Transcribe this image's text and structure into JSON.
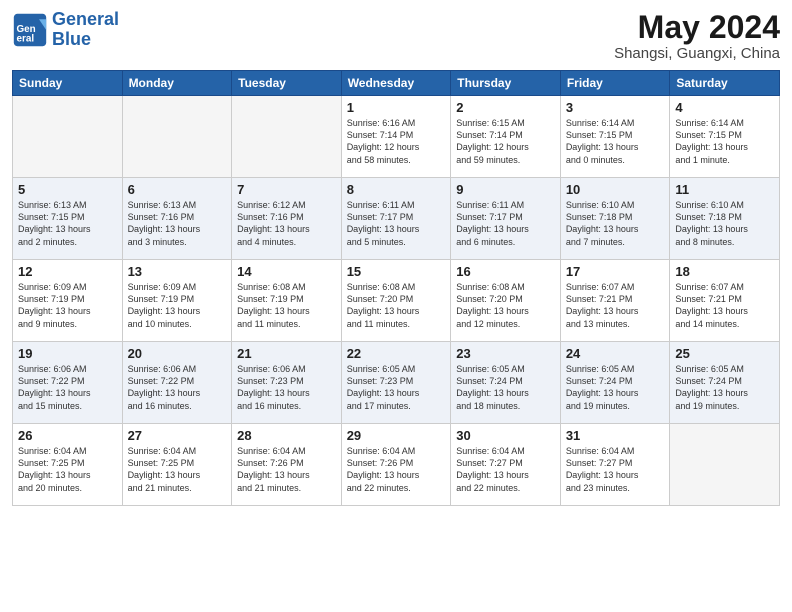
{
  "header": {
    "logo_line1": "General",
    "logo_line2": "Blue",
    "month": "May 2024",
    "location": "Shangsi, Guangxi, China"
  },
  "weekdays": [
    "Sunday",
    "Monday",
    "Tuesday",
    "Wednesday",
    "Thursday",
    "Friday",
    "Saturday"
  ],
  "weeks": [
    [
      {
        "day": "",
        "info": "",
        "empty": true
      },
      {
        "day": "",
        "info": "",
        "empty": true
      },
      {
        "day": "",
        "info": "",
        "empty": true
      },
      {
        "day": "1",
        "info": "Sunrise: 6:16 AM\nSunset: 7:14 PM\nDaylight: 12 hours\nand 58 minutes."
      },
      {
        "day": "2",
        "info": "Sunrise: 6:15 AM\nSunset: 7:14 PM\nDaylight: 12 hours\nand 59 minutes."
      },
      {
        "day": "3",
        "info": "Sunrise: 6:14 AM\nSunset: 7:15 PM\nDaylight: 13 hours\nand 0 minutes."
      },
      {
        "day": "4",
        "info": "Sunrise: 6:14 AM\nSunset: 7:15 PM\nDaylight: 13 hours\nand 1 minute."
      }
    ],
    [
      {
        "day": "5",
        "info": "Sunrise: 6:13 AM\nSunset: 7:15 PM\nDaylight: 13 hours\nand 2 minutes."
      },
      {
        "day": "6",
        "info": "Sunrise: 6:13 AM\nSunset: 7:16 PM\nDaylight: 13 hours\nand 3 minutes."
      },
      {
        "day": "7",
        "info": "Sunrise: 6:12 AM\nSunset: 7:16 PM\nDaylight: 13 hours\nand 4 minutes."
      },
      {
        "day": "8",
        "info": "Sunrise: 6:11 AM\nSunset: 7:17 PM\nDaylight: 13 hours\nand 5 minutes."
      },
      {
        "day": "9",
        "info": "Sunrise: 6:11 AM\nSunset: 7:17 PM\nDaylight: 13 hours\nand 6 minutes."
      },
      {
        "day": "10",
        "info": "Sunrise: 6:10 AM\nSunset: 7:18 PM\nDaylight: 13 hours\nand 7 minutes."
      },
      {
        "day": "11",
        "info": "Sunrise: 6:10 AM\nSunset: 7:18 PM\nDaylight: 13 hours\nand 8 minutes."
      }
    ],
    [
      {
        "day": "12",
        "info": "Sunrise: 6:09 AM\nSunset: 7:19 PM\nDaylight: 13 hours\nand 9 minutes."
      },
      {
        "day": "13",
        "info": "Sunrise: 6:09 AM\nSunset: 7:19 PM\nDaylight: 13 hours\nand 10 minutes."
      },
      {
        "day": "14",
        "info": "Sunrise: 6:08 AM\nSunset: 7:19 PM\nDaylight: 13 hours\nand 11 minutes."
      },
      {
        "day": "15",
        "info": "Sunrise: 6:08 AM\nSunset: 7:20 PM\nDaylight: 13 hours\nand 11 minutes."
      },
      {
        "day": "16",
        "info": "Sunrise: 6:08 AM\nSunset: 7:20 PM\nDaylight: 13 hours\nand 12 minutes."
      },
      {
        "day": "17",
        "info": "Sunrise: 6:07 AM\nSunset: 7:21 PM\nDaylight: 13 hours\nand 13 minutes."
      },
      {
        "day": "18",
        "info": "Sunrise: 6:07 AM\nSunset: 7:21 PM\nDaylight: 13 hours\nand 14 minutes."
      }
    ],
    [
      {
        "day": "19",
        "info": "Sunrise: 6:06 AM\nSunset: 7:22 PM\nDaylight: 13 hours\nand 15 minutes."
      },
      {
        "day": "20",
        "info": "Sunrise: 6:06 AM\nSunset: 7:22 PM\nDaylight: 13 hours\nand 16 minutes."
      },
      {
        "day": "21",
        "info": "Sunrise: 6:06 AM\nSunset: 7:23 PM\nDaylight: 13 hours\nand 16 minutes."
      },
      {
        "day": "22",
        "info": "Sunrise: 6:05 AM\nSunset: 7:23 PM\nDaylight: 13 hours\nand 17 minutes."
      },
      {
        "day": "23",
        "info": "Sunrise: 6:05 AM\nSunset: 7:24 PM\nDaylight: 13 hours\nand 18 minutes."
      },
      {
        "day": "24",
        "info": "Sunrise: 6:05 AM\nSunset: 7:24 PM\nDaylight: 13 hours\nand 19 minutes."
      },
      {
        "day": "25",
        "info": "Sunrise: 6:05 AM\nSunset: 7:24 PM\nDaylight: 13 hours\nand 19 minutes."
      }
    ],
    [
      {
        "day": "26",
        "info": "Sunrise: 6:04 AM\nSunset: 7:25 PM\nDaylight: 13 hours\nand 20 minutes."
      },
      {
        "day": "27",
        "info": "Sunrise: 6:04 AM\nSunset: 7:25 PM\nDaylight: 13 hours\nand 21 minutes."
      },
      {
        "day": "28",
        "info": "Sunrise: 6:04 AM\nSunset: 7:26 PM\nDaylight: 13 hours\nand 21 minutes."
      },
      {
        "day": "29",
        "info": "Sunrise: 6:04 AM\nSunset: 7:26 PM\nDaylight: 13 hours\nand 22 minutes."
      },
      {
        "day": "30",
        "info": "Sunrise: 6:04 AM\nSunset: 7:27 PM\nDaylight: 13 hours\nand 22 minutes."
      },
      {
        "day": "31",
        "info": "Sunrise: 6:04 AM\nSunset: 7:27 PM\nDaylight: 13 hours\nand 23 minutes."
      },
      {
        "day": "",
        "info": "",
        "empty": true
      }
    ]
  ]
}
